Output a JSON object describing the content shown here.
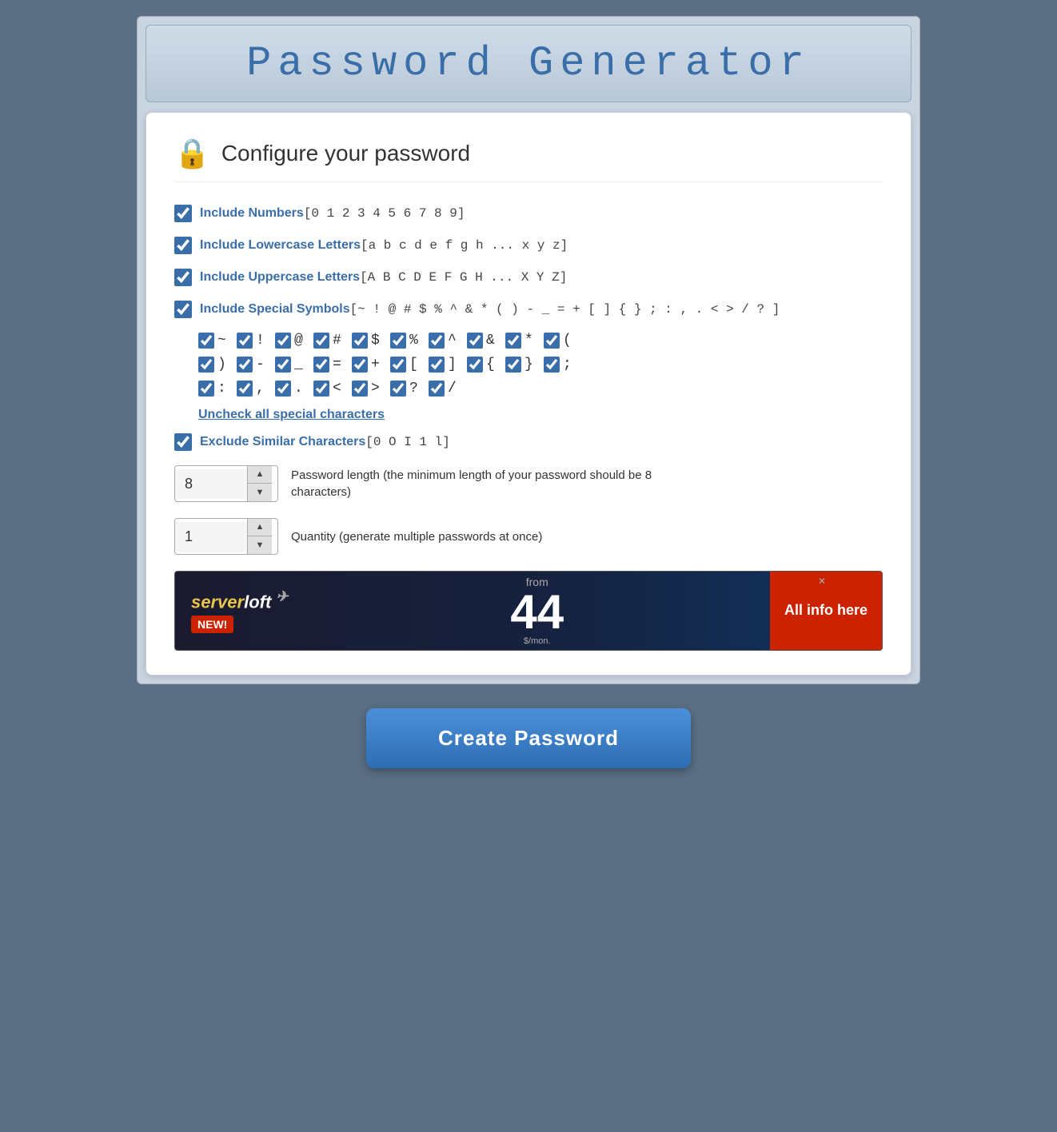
{
  "page": {
    "title": "Password Generator",
    "subtitle": "Configure your password"
  },
  "options": {
    "include_numbers": {
      "label": "Include Numbers",
      "chars": "[0 1 2 3 4 5 6 7 8 9]",
      "checked": true
    },
    "include_lowercase": {
      "label": "Include Lowercase Letters",
      "chars": "[a b c d e f g h ... x y z]",
      "checked": true
    },
    "include_uppercase": {
      "label": "Include Uppercase Letters",
      "chars": "[A B C D E F G H ... X Y Z]",
      "checked": true
    },
    "include_special": {
      "label": "Include Special Symbols",
      "chars": "[~ ! @ # $ % ^ & * ( ) - _ = + [ ] { } ; : , . < > / ? ]",
      "checked": true
    }
  },
  "special_chars": [
    "~",
    "!",
    "@",
    "#",
    "$",
    "%",
    "^",
    "&",
    "*",
    "(",
    ")",
    "–",
    "_",
    "=",
    "+",
    "[",
    "]",
    "{",
    "}",
    ";",
    ":",
    ",",
    ".",
    "<",
    ">",
    "?",
    "/"
  ],
  "uncheck_label": "Uncheck all special characters",
  "exclude_similar": {
    "label": "Exclude Similar Characters",
    "chars": "[0 O I 1 l]",
    "checked": true
  },
  "password_length": {
    "value": "8",
    "description": "Password length (the minimum length of your password should be 8 characters)"
  },
  "quantity": {
    "value": "1",
    "description": "Quantity (generate multiple passwords at once)"
  },
  "ad": {
    "brand": "serverloft",
    "new_label": "NEW!",
    "from_text": "from",
    "price": "44",
    "per_text": "$/mon.",
    "cta": "All info here"
  },
  "create_button": "Create Password"
}
